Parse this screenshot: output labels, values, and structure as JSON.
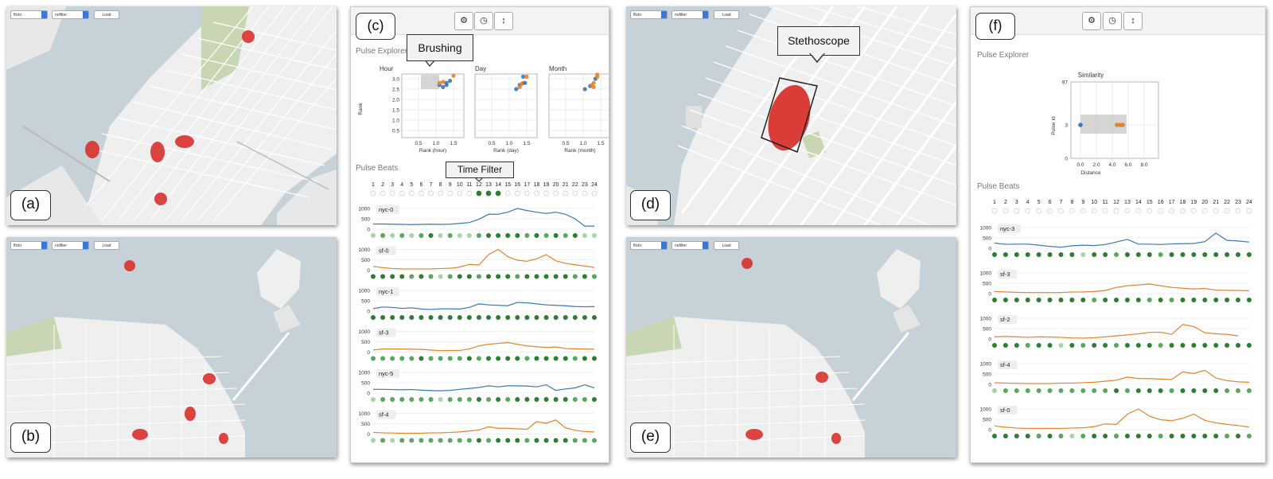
{
  "colors": {
    "water": "#c6d1d8",
    "land": "#efefef",
    "street": "#ffffff",
    "park": "#c8d6b3",
    "hotspot": "#d8312c",
    "blue": "#3b78b4",
    "orange": "#e3832b",
    "dot_dark": "#2e7d32",
    "dot_mid": "#5aa85c",
    "dot_light": "#a5d6a7"
  },
  "panel_labels": {
    "a": "(a)",
    "b": "(b)",
    "c": "(c)",
    "d": "(d)",
    "e": "(e)",
    "f": "(f)"
  },
  "map_controls": {
    "source": "flickr",
    "filter": "nofilter",
    "load": "Load"
  },
  "icons": {
    "settings": "gear-icon",
    "history": "clock-icon",
    "resize": "vertical-arrows-icon"
  },
  "callouts": {
    "brushing": "Brushing",
    "time_filter": "Time Filter",
    "stethoscope": "Stethoscope"
  },
  "pulse_explorer_title": "Pulse Explorer",
  "pulse_beats_title": "Pulse Beats",
  "explorer_c": {
    "y_label": "Rank",
    "y_ticks": [
      "3.0",
      "2.5",
      "2.0",
      "1.5",
      "1.0",
      "0.5"
    ],
    "x_ticks": [
      "0.5",
      "1.0",
      "1.5"
    ],
    "charts": [
      {
        "title": "Hour",
        "xlabel": "Rank (hour)",
        "points": [
          [
            1.1,
            2.7
          ],
          [
            1.2,
            2.6
          ],
          [
            1.3,
            2.8
          ],
          [
            1.2,
            2.85
          ],
          [
            1.1,
            2.8
          ],
          [
            1.4,
            2.9
          ],
          [
            1.5,
            3.15
          ],
          [
            1.3,
            2.7
          ]
        ],
        "colors": [
          "blue",
          "blue",
          "blue",
          "orange",
          "orange",
          "blue",
          "orange",
          "blue"
        ],
        "brush": true
      },
      {
        "title": "Day",
        "xlabel": "Rank (day)",
        "points": [
          [
            1.2,
            2.5
          ],
          [
            1.3,
            2.7
          ],
          [
            1.35,
            2.75
          ],
          [
            1.4,
            2.8
          ],
          [
            1.45,
            2.8
          ],
          [
            1.4,
            3.1
          ],
          [
            1.5,
            3.1
          ],
          [
            1.3,
            2.6
          ]
        ],
        "colors": [
          "blue",
          "blue",
          "orange",
          "orange",
          "blue",
          "blue",
          "orange",
          "orange"
        ],
        "brush": false
      },
      {
        "title": "Month",
        "xlabel": "Rank (month)",
        "points": [
          [
            1.05,
            2.5
          ],
          [
            1.2,
            2.65
          ],
          [
            1.25,
            2.7
          ],
          [
            1.3,
            2.8
          ],
          [
            1.35,
            3.0
          ],
          [
            1.4,
            3.1
          ],
          [
            1.3,
            2.6
          ],
          [
            1.4,
            3.2
          ]
        ],
        "colors": [
          "blue",
          "blue",
          "orange",
          "orange",
          "blue",
          "orange",
          "orange",
          "orange"
        ],
        "brush": false
      }
    ]
  },
  "explorer_f": {
    "title": "Similarity",
    "ylabel": "Pulse Id",
    "xlabel": "Distance",
    "y_ticks": [
      "97",
      "3",
      "0"
    ],
    "x_ticks": [
      "0.0",
      "2.0",
      "4.0",
      "6.0",
      "8.0"
    ],
    "points": [
      [
        0.0,
        3,
        "blue"
      ],
      [
        4.6,
        3,
        "orange"
      ],
      [
        5.0,
        3,
        "orange"
      ],
      [
        5.3,
        3,
        "orange"
      ]
    ]
  },
  "hours": [
    "1",
    "2",
    "3",
    "4",
    "5",
    "6",
    "7",
    "8",
    "9",
    "10",
    "11",
    "12",
    "13",
    "14",
    "15",
    "16",
    "17",
    "18",
    "19",
    "20",
    "21",
    "22",
    "23",
    "24"
  ],
  "beats_c_selected_hours": [
    12,
    13,
    14
  ],
  "beats_c": [
    {
      "name": "nyc-0",
      "series": "blue",
      "ticks": [
        "1000",
        "500",
        "0"
      ],
      "values": [
        250,
        250,
        240,
        230,
        220,
        230,
        240,
        230,
        240,
        280,
        320,
        480,
        720,
        720,
        820,
        1000,
        900,
        820,
        760,
        820,
        720,
        500,
        150,
        150
      ],
      "dots": [
        2,
        1,
        2,
        1,
        2,
        1,
        0,
        2,
        1,
        2,
        2,
        1,
        0,
        0,
        0,
        0,
        1,
        0,
        1,
        0,
        1,
        0,
        2,
        2
      ]
    },
    {
      "name": "sf-0",
      "series": "orange",
      "ticks": [
        "1000",
        "500",
        "0"
      ],
      "values": [
        180,
        120,
        80,
        60,
        60,
        60,
        60,
        80,
        90,
        150,
        280,
        250,
        750,
        1000,
        650,
        480,
        430,
        550,
        750,
        450,
        330,
        260,
        200,
        130
      ],
      "dots": [
        0,
        0,
        0,
        0,
        1,
        0,
        1,
        2,
        1,
        0,
        0,
        1,
        0,
        0,
        0,
        1,
        0,
        0,
        0,
        0,
        0,
        1,
        0,
        1
      ]
    },
    {
      "name": "nyc-1",
      "series": "blue",
      "ticks": [
        "1000",
        "500",
        "0"
      ],
      "values": [
        120,
        200,
        180,
        130,
        160,
        100,
        80,
        110,
        110,
        100,
        180,
        350,
        300,
        280,
        260,
        420,
        400,
        350,
        300,
        280,
        260,
        220,
        210,
        220
      ],
      "dots": [
        0,
        0,
        0,
        0,
        0,
        0,
        0,
        0,
        0,
        0,
        0,
        0,
        0,
        0,
        0,
        0,
        0,
        0,
        0,
        0,
        0,
        0,
        0,
        0
      ]
    },
    {
      "name": "sf-3",
      "series": "orange",
      "ticks": [
        "1000",
        "500",
        "0"
      ],
      "values": [
        100,
        150,
        150,
        150,
        140,
        130,
        100,
        70,
        80,
        80,
        150,
        300,
        380,
        420,
        460,
        380,
        300,
        260,
        220,
        250,
        170,
        160,
        150,
        140
      ],
      "dots": [
        1,
        1,
        1,
        1,
        1,
        0,
        1,
        1,
        1,
        1,
        0,
        1,
        0,
        0,
        0,
        0,
        1,
        0,
        0,
        0,
        0,
        1,
        0,
        0
      ]
    },
    {
      "name": "nyc-5",
      "series": "blue",
      "ticks": [
        "1000",
        "500",
        "0"
      ],
      "values": [
        180,
        180,
        170,
        160,
        170,
        140,
        120,
        110,
        130,
        180,
        220,
        270,
        350,
        300,
        350,
        350,
        340,
        300,
        400,
        130,
        200,
        250,
        400,
        250
      ],
      "dots": [
        2,
        1,
        1,
        1,
        1,
        1,
        1,
        2,
        1,
        1,
        1,
        0,
        1,
        0,
        1,
        0,
        0,
        0,
        0,
        0,
        0,
        1,
        1,
        0
      ]
    },
    {
      "name": "sf-4",
      "series": "orange",
      "ticks": [
        "1000",
        "500",
        "0"
      ],
      "values": [
        80,
        60,
        50,
        40,
        40,
        40,
        60,
        60,
        80,
        100,
        150,
        200,
        350,
        280,
        280,
        250,
        230,
        600,
        520,
        680,
        300,
        180,
        120,
        100
      ],
      "dots": [
        2,
        1,
        2,
        1,
        1,
        1,
        1,
        1,
        1,
        1,
        1,
        0,
        1,
        0,
        0,
        0,
        1,
        0,
        0,
        0,
        0,
        1,
        1,
        1
      ]
    }
  ],
  "beats_f": [
    {
      "name": "nyc-3",
      "series": "blue",
      "ticks": [
        "1000",
        "500",
        "0"
      ],
      "values": [
        250,
        190,
        200,
        200,
        150,
        90,
        50,
        120,
        150,
        130,
        180,
        300,
        430,
        200,
        200,
        180,
        210,
        220,
        230,
        320,
        730,
        380,
        350,
        300,
        250
      ],
      "dots": [
        0,
        0,
        0,
        0,
        0,
        0,
        0,
        0,
        2,
        0,
        0,
        1,
        0,
        0,
        0,
        1,
        0,
        0,
        0,
        0,
        0,
        0,
        0,
        0
      ]
    },
    {
      "name": "sf-3",
      "series": "orange",
      "ticks": [
        "1000",
        "500",
        "0"
      ],
      "values": [
        100,
        80,
        60,
        50,
        50,
        50,
        50,
        80,
        80,
        100,
        150,
        300,
        380,
        420,
        460,
        380,
        300,
        260,
        220,
        250,
        170,
        160,
        150,
        140
      ],
      "dots": [
        0,
        0,
        0,
        0,
        0,
        0,
        0,
        0,
        0,
        1,
        0,
        0,
        0,
        0,
        1,
        0,
        1,
        0,
        0,
        0,
        0,
        0,
        0,
        0
      ]
    },
    {
      "name": "sf-2",
      "series": "orange",
      "ticks": [
        "1000",
        "500",
        "0"
      ],
      "values": [
        100,
        120,
        100,
        80,
        100,
        90,
        80,
        50,
        40,
        60,
        100,
        150,
        200,
        250,
        320,
        330,
        220,
        700,
        600,
        300,
        250,
        220,
        150
      ],
      "dots": [
        0,
        0,
        0,
        1,
        0,
        0,
        2,
        0,
        1,
        0,
        0,
        1,
        0,
        0,
        0,
        1,
        0,
        0,
        0,
        0,
        0,
        0,
        0,
        0
      ]
    },
    {
      "name": "sf-4",
      "series": "orange",
      "ticks": [
        "1000",
        "500",
        "0"
      ],
      "values": [
        80,
        60,
        50,
        40,
        40,
        40,
        60,
        60,
        80,
        100,
        150,
        200,
        350,
        280,
        280,
        250,
        230,
        600,
        520,
        680,
        300,
        180,
        120,
        100
      ],
      "dots": [
        2,
        1,
        1,
        1,
        1,
        1,
        1,
        1,
        1,
        1,
        1,
        0,
        1,
        0,
        0,
        0,
        1,
        0,
        0,
        0,
        0,
        1,
        1,
        1
      ]
    },
    {
      "name": "sf-0",
      "series": "orange",
      "ticks": [
        "1000",
        "500",
        "0"
      ],
      "values": [
        180,
        120,
        80,
        60,
        60,
        60,
        60,
        80,
        90,
        150,
        280,
        250,
        750,
        1000,
        650,
        480,
        430,
        550,
        750,
        450,
        330,
        260,
        200,
        130
      ],
      "dots": [
        0,
        0,
        0,
        0,
        1,
        0,
        1,
        2,
        1,
        0,
        0,
        1,
        0,
        0,
        0,
        1,
        0,
        0,
        0,
        0,
        0,
        1,
        0,
        1
      ]
    }
  ]
}
